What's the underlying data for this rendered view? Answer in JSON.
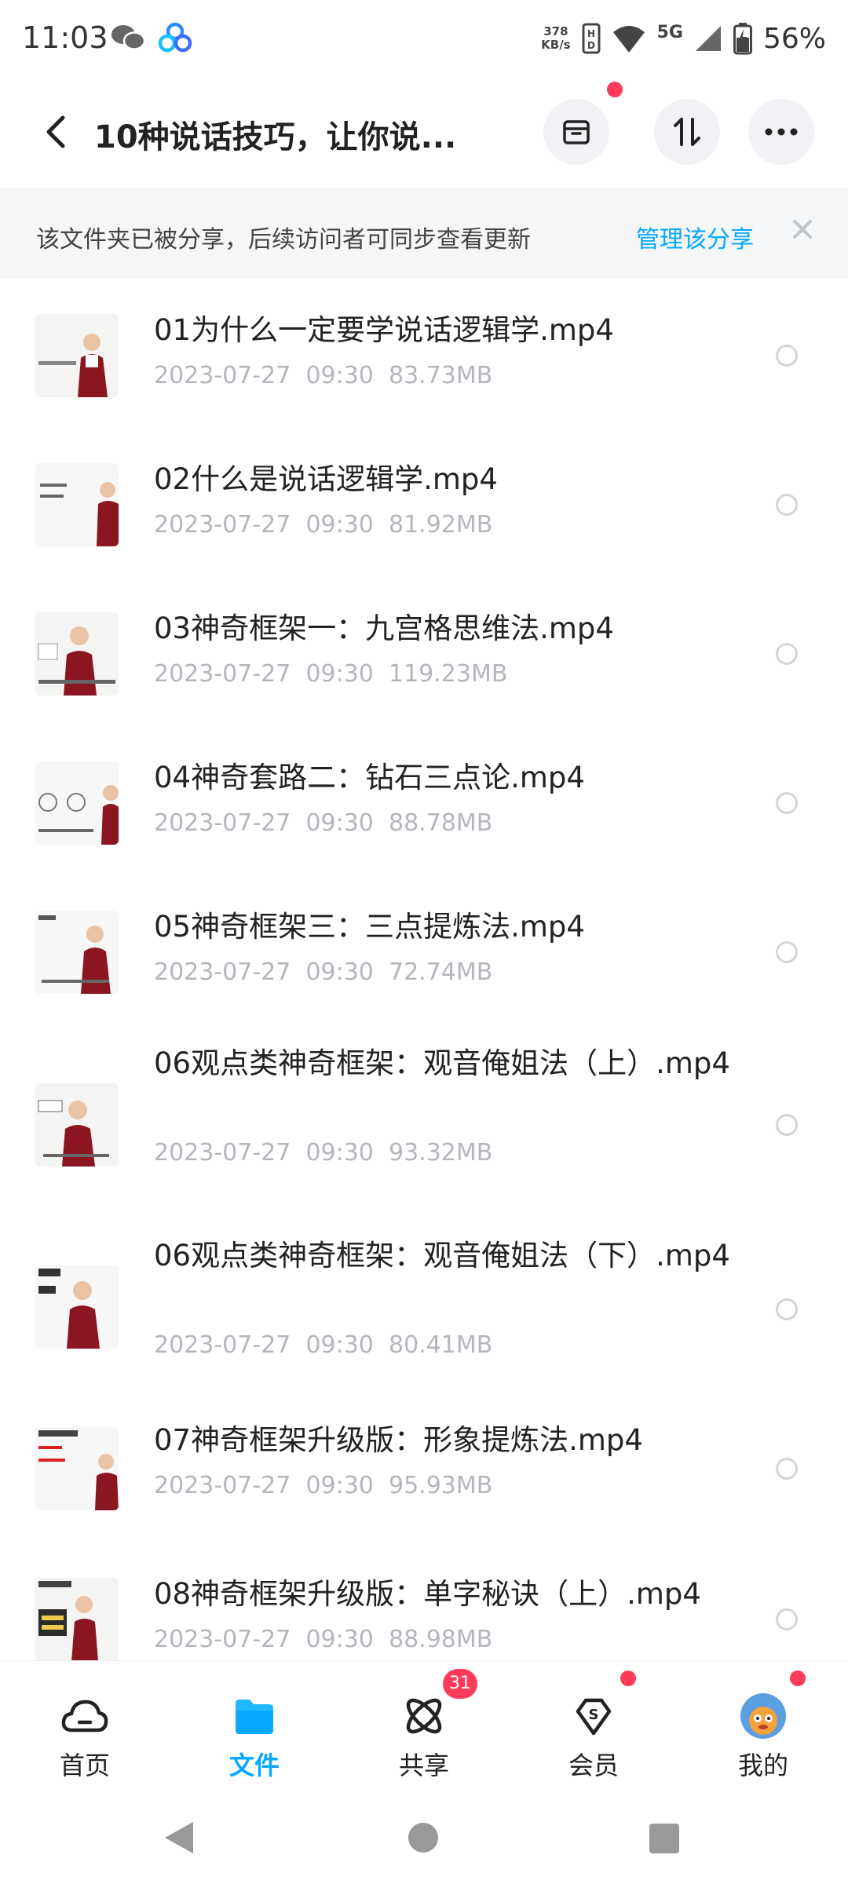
{
  "status_bar": {
    "time": "11:03",
    "net_speed_value": "378",
    "net_speed_unit": "KB/s",
    "network": "5G",
    "battery": "56%"
  },
  "header": {
    "title": "10种说话技巧，让你说...",
    "icons": [
      "back-arrow-icon",
      "archive-icon",
      "sort-icon",
      "more-icon"
    ]
  },
  "notice": {
    "text": "该文件夹已被分享，后续访问者可同步查看更新",
    "link": "管理该分享"
  },
  "files": [
    {
      "name": "01为什么一定要学说话逻辑学.mp4",
      "date": "2023-07-27",
      "time": "09:30",
      "size": "83.73MB"
    },
    {
      "name": "02什么是说话逻辑学.mp4",
      "date": "2023-07-27",
      "time": "09:30",
      "size": "81.92MB"
    },
    {
      "name": "03神奇框架一：九宫格思维法.mp4",
      "date": "2023-07-27",
      "time": "09:30",
      "size": "119.23MB"
    },
    {
      "name": "04神奇套路二：钻石三点论.mp4",
      "date": "2023-07-27",
      "time": "09:30",
      "size": "88.78MB"
    },
    {
      "name": "05神奇框架三：三点提炼法.mp4",
      "date": "2023-07-27",
      "time": "09:30",
      "size": "72.74MB"
    },
    {
      "name": "06观点类神奇框架：观音俺姐法（上）.mp4",
      "date": "2023-07-27",
      "time": "09:30",
      "size": "93.32MB"
    },
    {
      "name": "06观点类神奇框架：观音俺姐法（下）.mp4",
      "date": "2023-07-27",
      "time": "09:30",
      "size": "80.41MB"
    },
    {
      "name": "07神奇框架升级版：形象提炼法.mp4",
      "date": "2023-07-27",
      "time": "09:30",
      "size": "95.93MB"
    },
    {
      "name": "08神奇框架升级版：单字秘诀（上）.mp4",
      "date": "2023-07-27",
      "time": "09:30",
      "size": "88.98MB"
    }
  ],
  "bottom_nav": [
    {
      "label": "首页",
      "icon": "cloud-icon",
      "active": false
    },
    {
      "label": "文件",
      "icon": "folder-icon",
      "active": true
    },
    {
      "label": "共享",
      "icon": "share-atom-icon",
      "active": false,
      "badge": "31"
    },
    {
      "label": "会员",
      "icon": "vip-diamond-icon",
      "active": false,
      "dot": true
    },
    {
      "label": "我的",
      "icon": "avatar-icon",
      "active": false,
      "dot": true
    }
  ],
  "colors": {
    "accent": "#06a7ff",
    "badge": "#ff3b5c",
    "meta_text": "#b3b6bd",
    "notice_bg": "#f5f6f8"
  }
}
